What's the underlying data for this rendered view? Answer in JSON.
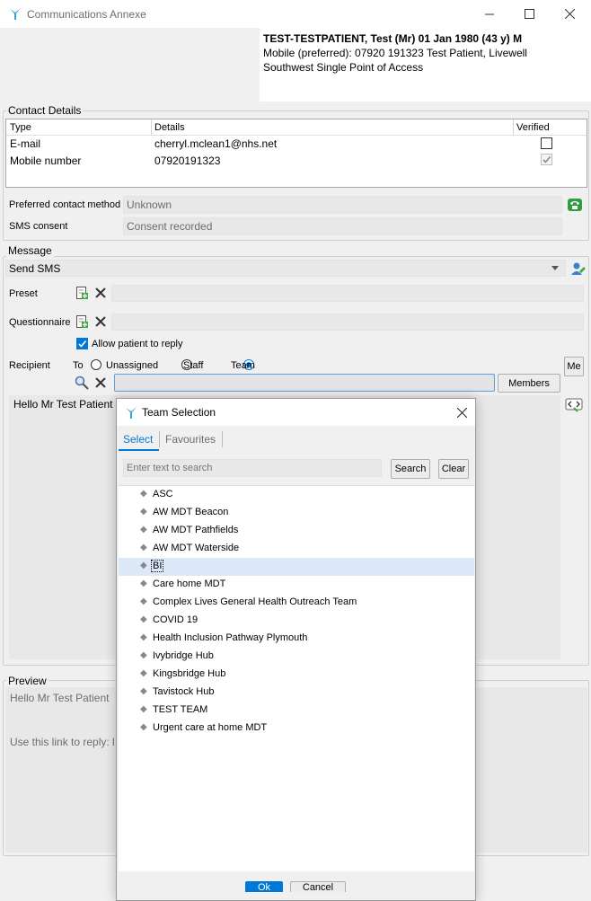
{
  "window": {
    "title": "Communications Annexe"
  },
  "patient": {
    "name_line": "TEST-TESTPATIENT, Test (Mr) 01 Jan 1980 (43 y) M",
    "contact_line": "Mobile (preferred): 07920 191323   Test Patient, Livewell",
    "service_line": "Southwest Single Point of Access"
  },
  "contact_details": {
    "group_label": "Contact Details",
    "columns": [
      "Type",
      "Details",
      "Verified"
    ],
    "rows": [
      {
        "type": "E-mail",
        "details": "cherryl.mclean1@nhs.net",
        "verified": false
      },
      {
        "type": "Mobile number",
        "details": "07920191323",
        "verified": true
      }
    ],
    "preferred_label": "Preferred contact method",
    "preferred_value": "Unknown",
    "sms_consent_label": "SMS consent",
    "sms_consent_value": "Consent recorded"
  },
  "message": {
    "group_label": "Message",
    "type_value": "Send SMS",
    "preset_label": "Preset",
    "questionnaire_label": "Questionnaire",
    "allow_reply_label": "Allow patient to reply",
    "allow_reply_checked": true,
    "recipient_label": "Recipient",
    "to_label": "To",
    "radio_options": [
      "Unassigned",
      "Staff",
      "Team"
    ],
    "selected_radio": "Team",
    "me_button": "Me",
    "members_button": "Members",
    "body_text": "Hello Mr Test Patient"
  },
  "preview": {
    "group_label": "Preview",
    "line1": "Hello Mr Test Patient",
    "line2": "Use this link to reply: l"
  },
  "team_dialog": {
    "title": "Team Selection",
    "tabs": [
      "Select",
      "Favourites"
    ],
    "active_tab": "Select",
    "search_placeholder": "Enter text to search",
    "search_button": "Search",
    "clear_button": "Clear",
    "teams": [
      "ASC",
      "AW MDT Beacon",
      "AW MDT Pathfields",
      "AW MDT Waterside",
      "BI",
      "Care home MDT",
      "Complex Lives General Health Outreach Team",
      "COVID 19",
      "Health Inclusion Pathway Plymouth",
      "Ivybridge Hub",
      "Kingsbridge Hub",
      "Tavistock Hub",
      "TEST TEAM",
      "Urgent care at home MDT"
    ],
    "selected_team": "BI",
    "ok_button": "Ok",
    "cancel_button": "Cancel"
  },
  "colors": {
    "accent": "#0078d7",
    "selection": "#dde8f8",
    "field_bg": "#e8e8e8",
    "window_bg": "#f0f0f0"
  }
}
